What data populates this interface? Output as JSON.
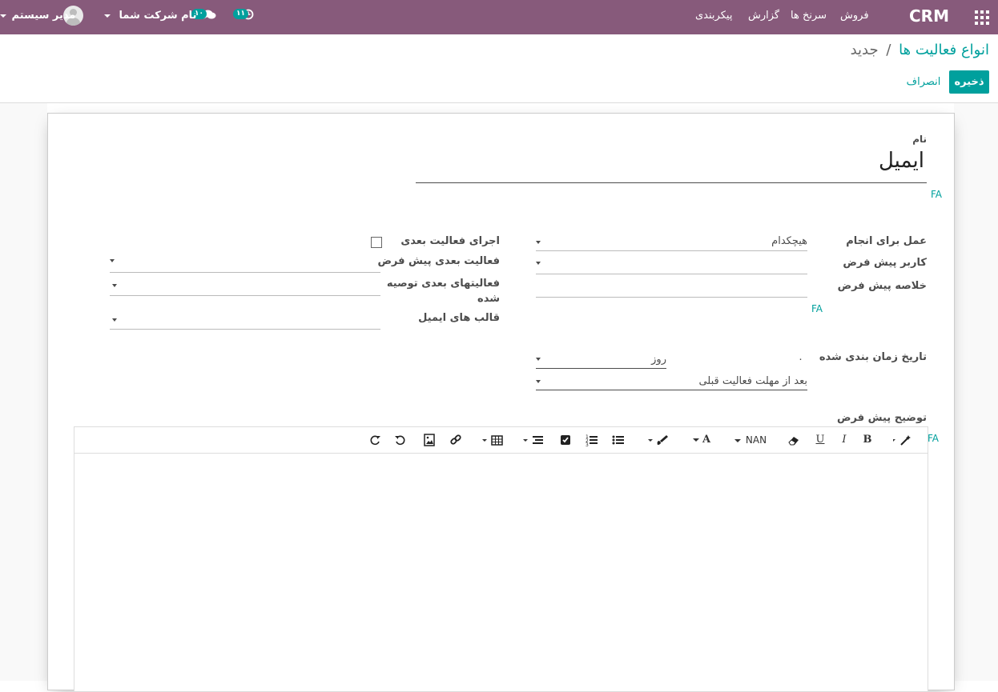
{
  "navbar": {
    "brand": "CRM",
    "menu": [
      "فروش",
      "سرنخ ها",
      "گزارش",
      "پیکربندی"
    ],
    "activities_badge": "۱۱",
    "messages_badge": "۱۰",
    "company": "نام شرکت شما",
    "user": "مدیر سیستم"
  },
  "breadcrumb": {
    "parent": "انواع فعالیت ها",
    "separator": "/",
    "current": "جدید"
  },
  "buttons": {
    "save": "ذخیره",
    "discard": "انصراف"
  },
  "form": {
    "name_label": "نام",
    "name_value": "ایمیل",
    "lang_tag": "FA",
    "action_label": "عمل برای انجام",
    "action_value": "هیچکدام",
    "default_user_label": "کاربر پیش فرض",
    "default_summary_label": "خلاصه پیش فرض",
    "schedule_label": "تاریخ زمان بندی شده",
    "schedule_delay_value": "۰",
    "schedule_unit_value": "روز",
    "schedule_from_value": "بعد از مهلت فعالیت قبلی",
    "trigger_next_label": "اجرای فعالیت بعدی",
    "default_next_label": "فعالیت بعدی پیش فرض",
    "recommended_next_label_line1": "فعالیتهای بعدی توصیه",
    "recommended_next_label_line2": "شده",
    "email_templates_label": "قالب های ایمیل",
    "description_label": "توضیح پیش فرض"
  },
  "editor": {
    "font_size_value": "NAN",
    "tools": [
      "magic-wand",
      "bold",
      "italic",
      "underline",
      "eraser",
      "font-size",
      "font-color",
      "paint-brush",
      "unordered-list",
      "ordered-list",
      "checklist",
      "paragraph",
      "table",
      "link",
      "picture",
      "undo",
      "redo"
    ]
  },
  "colors": {
    "primary": "#875a7b",
    "accent": "#00a09d"
  }
}
